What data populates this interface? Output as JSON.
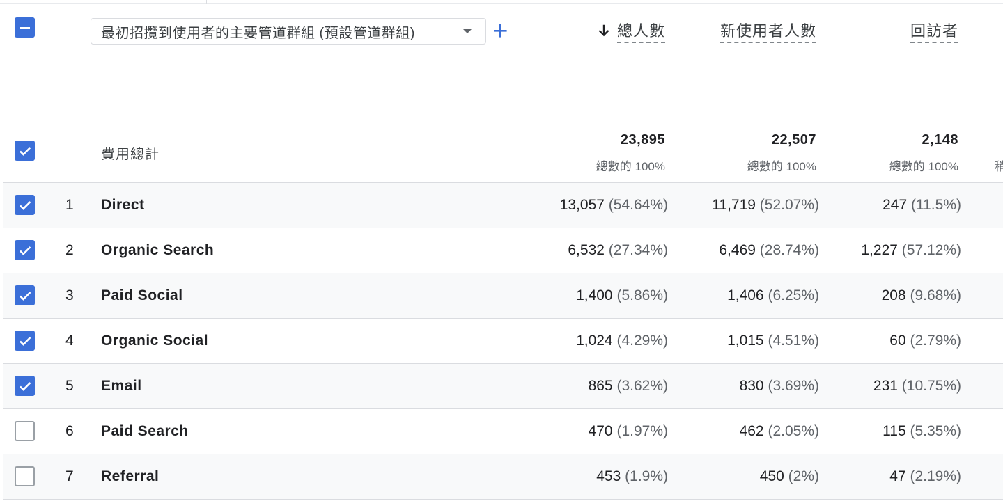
{
  "header": {
    "dimension_label": "最初招攬到使用者的主要管道群組 (預設管道群組)",
    "metrics": [
      {
        "name": "總人數",
        "sorted": true
      },
      {
        "name": "新使用者人數",
        "sorted": false
      },
      {
        "name": "回訪者",
        "sorted": false
      }
    ],
    "totals_label": "費用總計",
    "totals": [
      {
        "value": "23,895",
        "pct": "總數的 100%"
      },
      {
        "value": "22,507",
        "pct": "總數的 100%"
      },
      {
        "value": "2,148",
        "pct": "總數的 100%"
      }
    ],
    "cut_text": "稍"
  },
  "colors": {
    "accent": "#3b6fd8",
    "row_shade": "#f8f9fa",
    "divider": "#dadce0"
  },
  "rows": [
    {
      "index": "1",
      "dim": "Direct",
      "checked": true,
      "cells": [
        {
          "v": "13,057",
          "p": "(54.64%)"
        },
        {
          "v": "11,719",
          "p": "(52.07%)"
        },
        {
          "v": "247",
          "p": "(11.5%)"
        }
      ]
    },
    {
      "index": "2",
      "dim": "Organic Search",
      "checked": true,
      "cells": [
        {
          "v": "6,532",
          "p": "(27.34%)"
        },
        {
          "v": "6,469",
          "p": "(28.74%)"
        },
        {
          "v": "1,227",
          "p": "(57.12%)"
        }
      ]
    },
    {
      "index": "3",
      "dim": "Paid Social",
      "checked": true,
      "cells": [
        {
          "v": "1,400",
          "p": "(5.86%)"
        },
        {
          "v": "1,406",
          "p": "(6.25%)"
        },
        {
          "v": "208",
          "p": "(9.68%)"
        }
      ]
    },
    {
      "index": "4",
      "dim": "Organic Social",
      "checked": true,
      "cells": [
        {
          "v": "1,024",
          "p": "(4.29%)"
        },
        {
          "v": "1,015",
          "p": "(4.51%)"
        },
        {
          "v": "60",
          "p": "(2.79%)"
        }
      ]
    },
    {
      "index": "5",
      "dim": "Email",
      "checked": true,
      "cells": [
        {
          "v": "865",
          "p": "(3.62%)"
        },
        {
          "v": "830",
          "p": "(3.69%)"
        },
        {
          "v": "231",
          "p": "(10.75%)"
        }
      ]
    },
    {
      "index": "6",
      "dim": "Paid Search",
      "checked": false,
      "cells": [
        {
          "v": "470",
          "p": "(1.97%)"
        },
        {
          "v": "462",
          "p": "(2.05%)"
        },
        {
          "v": "115",
          "p": "(5.35%)"
        }
      ]
    },
    {
      "index": "7",
      "dim": "Referral",
      "checked": false,
      "cells": [
        {
          "v": "453",
          "p": "(1.9%)"
        },
        {
          "v": "450",
          "p": "(2%)"
        },
        {
          "v": "47",
          "p": "(2.19%)"
        }
      ]
    }
  ]
}
